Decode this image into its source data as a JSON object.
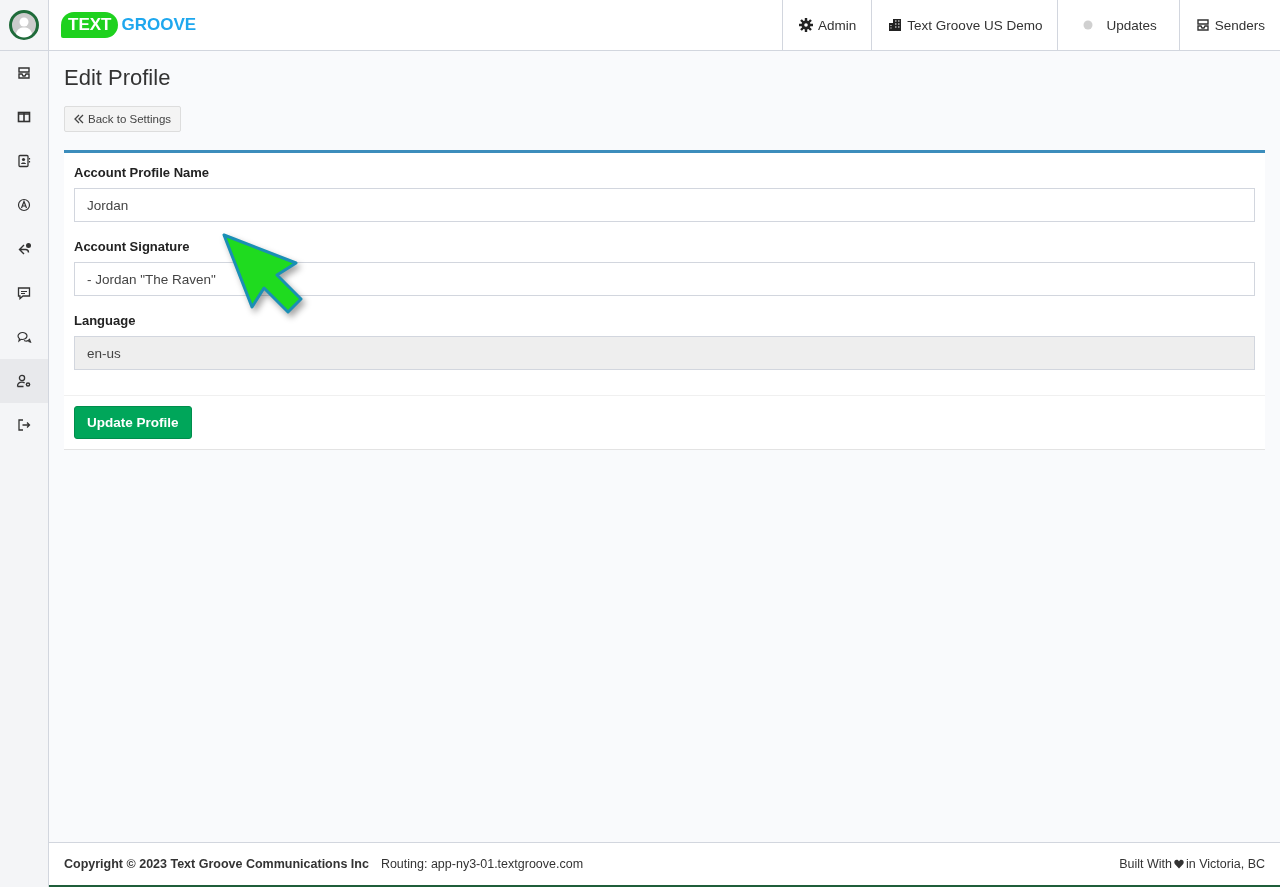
{
  "logo": {
    "bubble": "TEXT",
    "word": "GROOVE"
  },
  "top_nav": [
    {
      "kind": "gear",
      "label": "Admin"
    },
    {
      "kind": "building",
      "label": "Text Groove US Demo"
    },
    {
      "kind": "dot",
      "label": "Updates"
    },
    {
      "kind": "inbox",
      "label": "Senders"
    }
  ],
  "sidebar": {
    "items": [
      {
        "kind": "inbox",
        "selected": false
      },
      {
        "kind": "columns",
        "selected": false
      },
      {
        "kind": "contact",
        "selected": false
      },
      {
        "kind": "compass",
        "selected": false
      },
      {
        "kind": "reply",
        "selected": false
      },
      {
        "kind": "message",
        "selected": false
      },
      {
        "kind": "chats",
        "selected": false
      },
      {
        "kind": "user-gear",
        "selected": true
      },
      {
        "kind": "logout",
        "selected": false
      }
    ]
  },
  "page_title": "Edit Profile",
  "back_button": "Back to Settings",
  "form": {
    "fields": [
      {
        "label": "Account Profile Name",
        "value": "Jordan",
        "disabled": false
      },
      {
        "label": "Account Signature",
        "value": "- Jordan \"The Raven\"",
        "disabled": false
      },
      {
        "label": "Language",
        "value": "en-us",
        "disabled": true
      }
    ],
    "submit": "Update Profile"
  },
  "footer": {
    "copyright": "Copyright © 2023 Text Groove Communications Inc",
    "routing": "Routing: app-ny3-01.textgroove.com",
    "built_with": "Built With",
    "location": "in Victoria, BC"
  }
}
